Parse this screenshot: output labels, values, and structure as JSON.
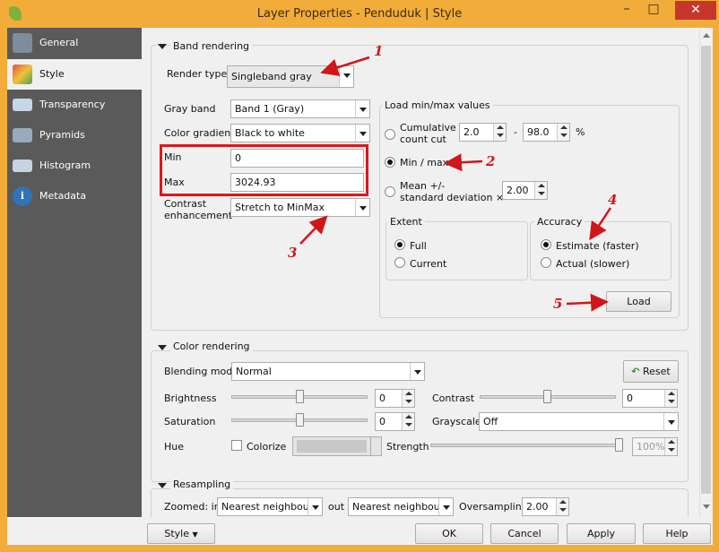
{
  "window": {
    "title": "Layer Properties - Penduduk | Style",
    "minimize": "–",
    "maximize": "□",
    "close": "✕"
  },
  "sidebar": {
    "items": [
      {
        "label": "General",
        "icon": "wrench-icon",
        "color": "#7f8c9a"
      },
      {
        "label": "Style",
        "icon": "paintbrush-icon",
        "color": "#b0c0d0"
      },
      {
        "label": "Transparency",
        "icon": "transparency-icon",
        "color": "#c9d6e8"
      },
      {
        "label": "Pyramids",
        "icon": "pyramid-icon",
        "color": "#9aa9bb"
      },
      {
        "label": "Histogram",
        "icon": "histogram-icon",
        "color": "#c8d3e2"
      },
      {
        "label": "Metadata",
        "icon": "info-icon",
        "color": "#2f73b8"
      }
    ]
  },
  "band": {
    "title": "Band rendering",
    "render_type_label": "Render type",
    "render_type": "Singleband gray",
    "gray_band_label": "Gray band",
    "gray_band": "Band 1 (Gray)",
    "gradient_label": "Color gradient",
    "gradient": "Black to white",
    "min_label": "Min",
    "min": "0",
    "max_label": "Max",
    "max": "3024.93",
    "contrast_label_1": "Contrast",
    "contrast_label_2": "enhancement",
    "contrast": "Stretch to MinMax"
  },
  "minmax": {
    "title": "Load min/max values",
    "cumulative_1": "Cumulative",
    "cumulative_2": "count cut",
    "cum_low": "2.0",
    "dash": "-",
    "cum_high": "98.0",
    "pct": "%",
    "minmax_label": "Min / max",
    "mean_1": "Mean +/-",
    "mean_2": "standard deviation ×",
    "std": "2.00",
    "extent_title": "Extent",
    "full": "Full",
    "current": "Current",
    "accuracy_title": "Accuracy",
    "estimate": "Estimate (faster)",
    "actual": "Actual (slower)",
    "load": "Load"
  },
  "color": {
    "title": "Color rendering",
    "blending_label": "Blending mode",
    "blending": "Normal",
    "reset": "Reset",
    "brightness_label": "Brightness",
    "brightness": "0",
    "contrast_label": "Contrast",
    "contrast": "0",
    "saturation_label": "Saturation",
    "saturation": "0",
    "grayscale_label": "Grayscale",
    "grayscale": "Off",
    "hue_label": "Hue",
    "colorize_label": "Colorize",
    "strength_label": "Strength",
    "strength": "100%"
  },
  "resampling": {
    "title": "Resampling",
    "zoomed_in_label": "Zoomed: in",
    "zoomed_in": "Nearest neighbour",
    "out_label": "out",
    "zoomed_out": "Nearest neighbour",
    "oversampling_label": "Oversampling",
    "oversampling": "2.00"
  },
  "footer": {
    "style": "Style",
    "ok": "OK",
    "cancel": "Cancel",
    "apply": "Apply",
    "help": "Help"
  },
  "annotations": {
    "n1": "1",
    "n2": "2",
    "n3": "3",
    "n4": "4",
    "n5": "5"
  },
  "colors": {
    "titlebar": "#f2ac3a",
    "close": "#c7362d",
    "sidebar": "#5a5a5a",
    "annotation": "#d0161b"
  }
}
